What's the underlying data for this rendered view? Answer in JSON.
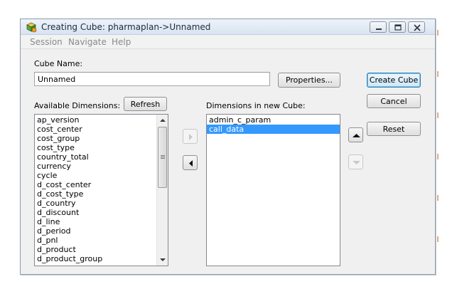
{
  "window": {
    "title": "Creating Cube: pharmaplan->Unnamed"
  },
  "menu": [
    "Session",
    "Navigate",
    "Help"
  ],
  "cube_name": {
    "label": "Cube Name:",
    "value": "Unnamed"
  },
  "buttons": {
    "properties": "Properties...",
    "create_cube": "Create Cube",
    "cancel": "Cancel",
    "reset": "Reset",
    "refresh": "Refresh"
  },
  "available": {
    "label": "Available Dimensions:",
    "items": [
      "ap_version",
      "cost_center",
      "cost_group",
      "cost_type",
      "country_total",
      "currency",
      "cycle",
      "d_cost_center",
      "d_cost_type",
      "d_country",
      "d_discount",
      "d_line",
      "d_period",
      "d_pnl",
      "d_product",
      "d_product_group"
    ]
  },
  "selected_dims": {
    "label": "Dimensions in new Cube:",
    "items": [
      "admin_c_param",
      "call_data"
    ],
    "selected_index": 1
  },
  "colors": {
    "selection": "#3399ff",
    "default_button_border": "#3c7fb1",
    "disabled_arrow": "#c9c9c9"
  },
  "icons": {
    "app": "cube-app-icon",
    "add": "arrow-right-icon",
    "remove": "arrow-left-icon",
    "move_up": "arrow-up-icon",
    "move_down": "arrow-down-icon"
  }
}
